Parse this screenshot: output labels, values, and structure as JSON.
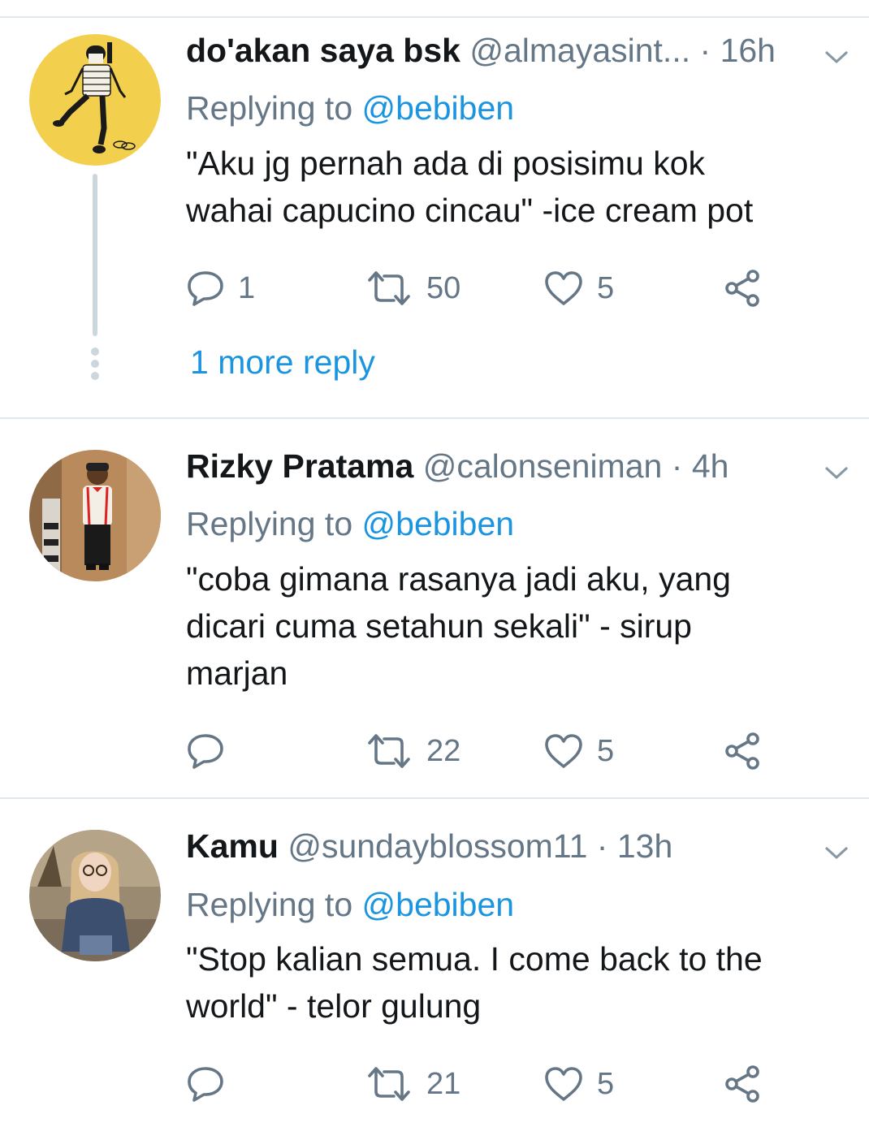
{
  "colors": {
    "text": "#14171a",
    "secondary": "#657786",
    "link": "#1b95e0",
    "divider": "#e1e8ed",
    "thread": "#ccd6dd"
  },
  "tweets": [
    {
      "name": "do'akan saya bsk",
      "handle": "@almayasint...",
      "dot": "·",
      "time": "16h",
      "replying_prefix": "Replying to",
      "replying_to": "@bebiben",
      "text": "\"Aku jg pernah ada di posisimu kok\nwahai capucino cincau\" -ice cream pot",
      "replies": "1",
      "retweets": "50",
      "likes": "5",
      "more_replies": "1 more reply",
      "avatar_icon": "illustrated-person-avatar"
    },
    {
      "name": "Rizky Pratama",
      "handle": "@calonseniman",
      "dot": "·",
      "time": "4h",
      "replying_prefix": "Replying to",
      "replying_to": "@bebiben",
      "text": "\"coba gimana rasanya jadi aku, yang\ndicari cuma setahun sekali\" - sirup\nmarjan",
      "replies": "",
      "retweets": "22",
      "likes": "5",
      "avatar_icon": "photo-person-avatar"
    },
    {
      "name": "Kamu",
      "handle": "@sundayblossom11",
      "dot": "·",
      "time": "13h",
      "replying_prefix": "Replying to",
      "replying_to": "@bebiben",
      "text": "\"Stop kalian semua. I come back to the\nworld\" - telor gulung",
      "replies": "",
      "retweets": "21",
      "likes": "5",
      "avatar_icon": "photo-person-avatar"
    }
  ],
  "icons": {
    "reply": "reply-icon",
    "retweet": "retweet-icon",
    "like": "heart-icon",
    "share": "share-icon",
    "menu": "chevron-down-icon"
  }
}
